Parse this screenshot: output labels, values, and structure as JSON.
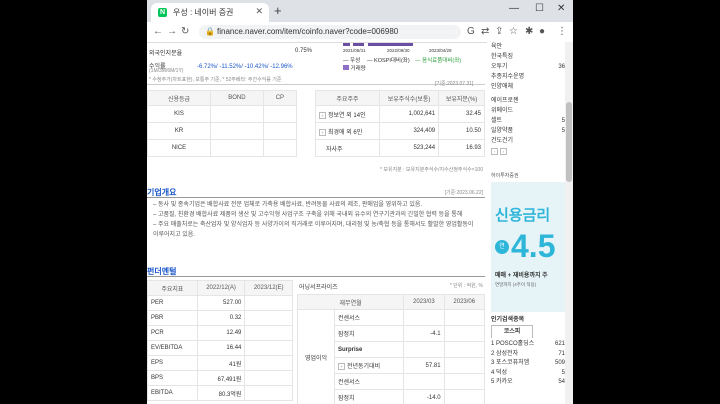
{
  "browser": {
    "tab_title": "우성 : 네이버 증권",
    "url": "finance.naver.com/item/coinfo.naver?code=006980"
  },
  "top": {
    "foreign_label": "외국인지분율",
    "foreign_value": "0.75%",
    "return_label": "수익률",
    "return_sub": "(1M/3M/6M/1Y)",
    "return_value": "-6.72%/ -11.52%/ -10.42%/ -12.96%",
    "note": "* 수정주가(차트표현), 보통주 기준, * 52주베타: 주간수익률 기준",
    "chart_dates": [
      "2021/05/31",
      "2022/09/30",
      "2023/04/29"
    ],
    "legend": [
      "우성",
      "KOSPI대비(좌)",
      "음식료품대비(좌)",
      "거래량"
    ]
  },
  "credit": {
    "headers": [
      "신용등급",
      "BOND",
      "CP"
    ],
    "rows": [
      [
        "KIS",
        "",
        ""
      ],
      [
        "KR",
        "",
        ""
      ],
      [
        "NICE",
        "",
        ""
      ]
    ]
  },
  "holders": {
    "date": "[기준:2023.07.31]",
    "headers": [
      "주요주주",
      "보유주식수(보통)",
      "보유지분(%)"
    ],
    "rows": [
      [
        "정보연 외 14인",
        "1,002,641",
        "32.45"
      ],
      [
        "최경애 외 6인",
        "324,409",
        "10.50"
      ],
      [
        "자사주",
        "523,244",
        "16.93"
      ]
    ],
    "note": "* 보유지분 : 보유지분주식수/지수산정주식수×100"
  },
  "overview": {
    "title": "기업개요",
    "date": "[기준:2023.06.22]",
    "items": [
      "동사 및 종속기업은 배합사료 전문 업체로 가축용 배합사료, 반려동물 사료의 제조, 판매업을 영위하고 있음.",
      "고품질, 친환경 배합사료 제품의 생산 및 고수익형 사업구조 구축을 위해 국내외 유수의 연구기관과의 긴밀한 협력 등을 통해",
      "주요 매출처로는 축산업자 및 양식업자 등 사양가이의 직거래로 이루어지며, 대리점 및 농/축협 등을 통해서도 활발한 영업활동이 이루어지고 있음."
    ]
  },
  "fundamentals": {
    "title": "펀더멘털",
    "headers": [
      "주요지표",
      "2022/12(A)",
      "2023/12(E)"
    ],
    "rows": [
      [
        "PER",
        "527.00",
        ""
      ],
      [
        "PBR",
        "0.32",
        ""
      ],
      [
        "PCR",
        "12.49",
        ""
      ],
      [
        "EV/EBITDA",
        "16.44",
        ""
      ],
      [
        "EPS",
        "41원",
        ""
      ],
      [
        "BPS",
        "67,491원",
        ""
      ],
      [
        "EBITDA",
        "80.3억원",
        ""
      ]
    ]
  },
  "earnings": {
    "title": "어닝서프라이즈",
    "unit": "* 단위 : 억원, %",
    "headers": [
      "재무연월",
      "",
      "2023/03",
      "2023/06"
    ],
    "group_label": "영업이익",
    "rows": [
      [
        "컨센서스",
        "",
        ""
      ],
      [
        "잠정치",
        "-4.1",
        ""
      ],
      [
        "Surprise",
        "",
        ""
      ],
      [
        "전년동기대비",
        "57.81",
        ""
      ],
      [
        "컨센서스",
        "",
        ""
      ],
      [
        "잠정치",
        "-14.0",
        ""
      ]
    ]
  },
  "sidebar": {
    "items1": [
      {
        "label": "육안",
        "value": ""
      },
      {
        "label": "한국특징",
        "value": ""
      },
      {
        "label": "오투기",
        "value": "36"
      },
      {
        "label": "추종지수운명",
        "value": ""
      },
      {
        "label": "인양애체",
        "value": ""
      }
    ],
    "items2": [
      {
        "label": "에이프로젠",
        "value": ""
      },
      {
        "label": "위메이드",
        "value": ""
      },
      {
        "label": "셀트",
        "value": "5"
      },
      {
        "label": "일양약품",
        "value": "5"
      },
      {
        "label": "건도건기",
        "value": ""
      }
    ],
    "ad_brand": "하이투자증권",
    "ad_title": "신용금리",
    "ad_number": "4.5",
    "ad_line1": "매매 + 재비용까지 주",
    "ad_line2": "연말까지 (4주이 적용)",
    "popular_title": "인기검색종목",
    "popular_tab": "코스피",
    "popular": [
      {
        "rank": "1",
        "name": "POSCO홀딩스",
        "value": "621"
      },
      {
        "rank": "2",
        "name": "삼성전자",
        "value": "71"
      },
      {
        "rank": "3",
        "name": "포스코퓨처엠",
        "value": "509"
      },
      {
        "rank": "4",
        "name": "덕성",
        "value": "5"
      },
      {
        "rank": "5",
        "name": "카카오",
        "value": "54"
      }
    ]
  },
  "colors": {
    "accent": "#1a56c8",
    "naver": "#03c75a",
    "ad": "#2eb6d9"
  }
}
